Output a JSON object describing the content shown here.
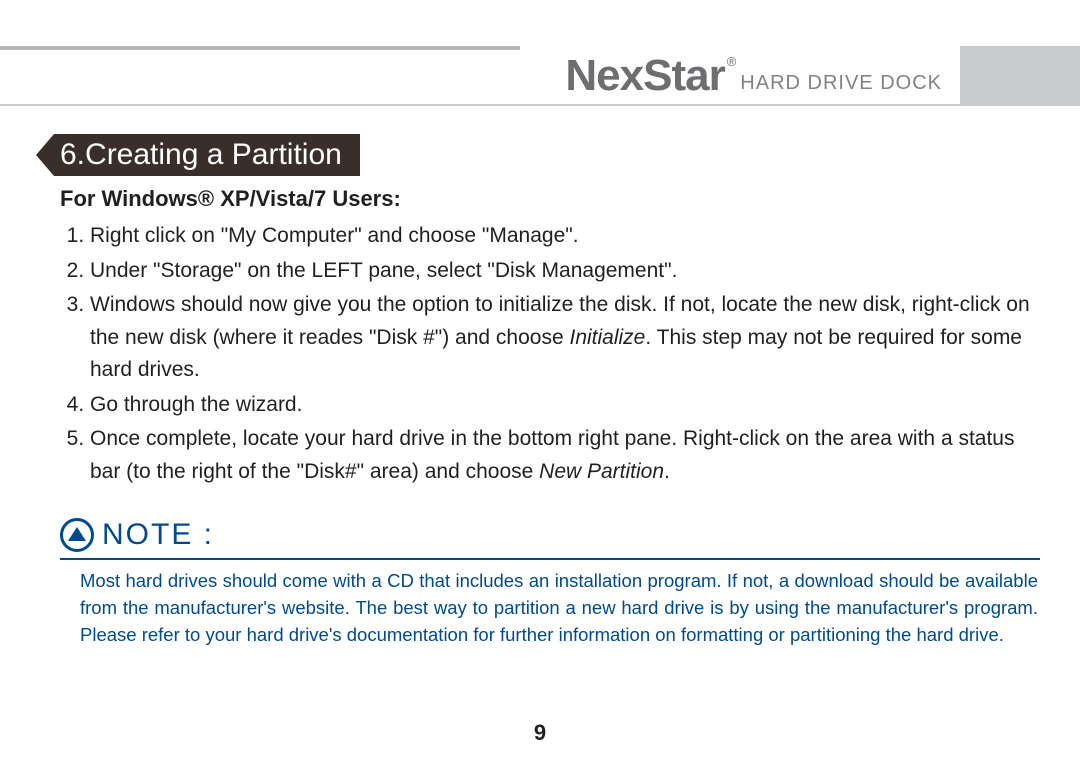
{
  "brand": {
    "main": "NexStar",
    "registered": "®",
    "sub": "HARD DRIVE DOCK"
  },
  "section": {
    "number": "6.",
    "title": "Creating a Partition"
  },
  "subheading": "For Windows® XP/Vista/7 Users:",
  "steps": [
    {
      "text_a": "Right click on \"My Computer\" and choose \"Manage\"."
    },
    {
      "text_a": "Under \"Storage\" on the LEFT pane, select \"Disk Management\"."
    },
    {
      "text_a": "Windows should now give you the option to initialize the disk. If not, locate the new disk, right-click on the new disk (where it reades \"Disk #\") and choose ",
      "italic": "Initialize",
      "text_b": ". This step may not be required for some hard drives."
    },
    {
      "text_a": "Go through the wizard."
    },
    {
      "text_a": "Once complete, locate your hard drive in the bottom right pane. Right-click on the area with a status bar (to the right of the \"Disk#\" area) and choose ",
      "italic": "New Partition",
      "text_b": "."
    }
  ],
  "note": {
    "label": "NOTE :",
    "body": "Most hard drives should come with a CD that includes an installation program. If not, a download should be available from the manufacturer's website. The best way to partition a new hard drive is by using the manufacturer's program. Please refer to your hard drive's documentation for further information on formatting or partitioning the hard drive."
  },
  "page_number": "9"
}
